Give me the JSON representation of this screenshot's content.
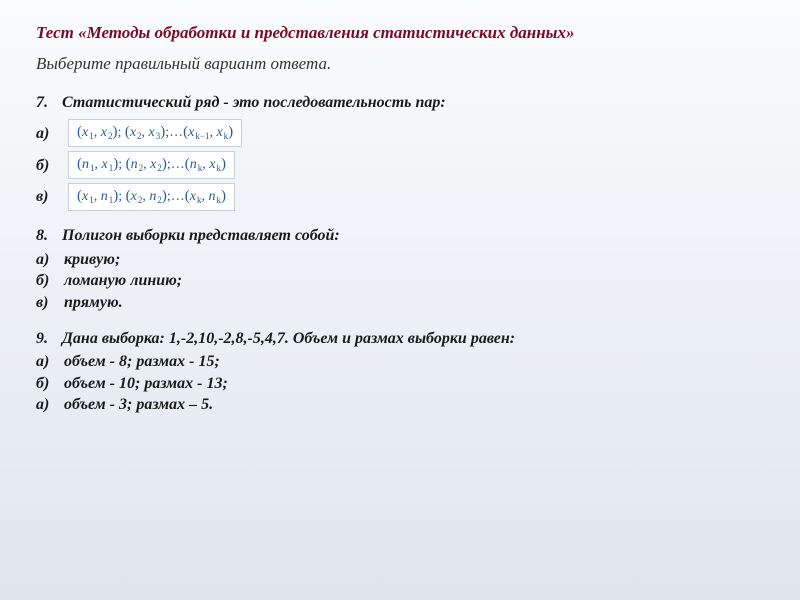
{
  "title": "Тест «Методы обработки и представления статистических данных»",
  "instruction": "Выберите правильный вариант ответа.",
  "q7": {
    "num": "7.",
    "text": "Статистический ряд - это последовательность пар:",
    "opts": [
      {
        "label": "а)"
      },
      {
        "label": "б)"
      },
      {
        "label": "в)"
      }
    ]
  },
  "q8": {
    "num": "8.",
    "text": "Полигон выборки представляет собой:",
    "opts": [
      {
        "label": "а)",
        "text": "кривую;"
      },
      {
        "label": "б)",
        "text": "ломаную линию;"
      },
      {
        "label": "в)",
        "text": "прямую."
      }
    ]
  },
  "q9": {
    "num": "9.",
    "text": "Дана выборка: 1,-2,10,-2,8,-5,4,7. Объем и  размах выборки равен:",
    "opts": [
      {
        "label": "а)",
        "text": "объем - 8; размах - 15;"
      },
      {
        "label": "б)",
        "text": "объем - 10; размах - 13;"
      },
      {
        "label": "а)",
        "text": "объем - 3; размах – 5."
      }
    ]
  }
}
